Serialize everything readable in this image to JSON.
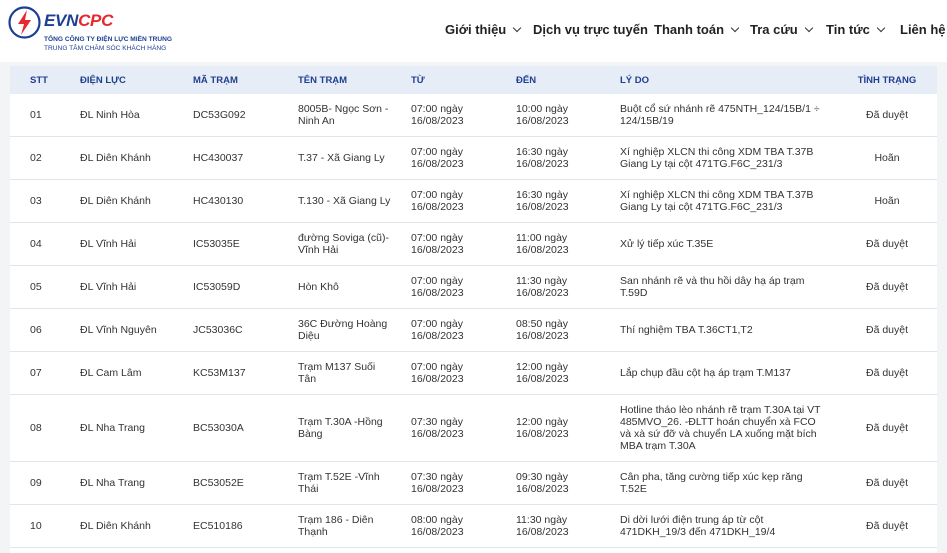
{
  "brand": {
    "name_evn": "EVN",
    "name_cpc": "CPC",
    "line1": "TỔNG CÔNG TY ĐIỆN LỰC MIỀN TRUNG",
    "line2": "TRUNG TÂM CHĂM SÓC KHÁCH HÀNG",
    "colors": {
      "blue": "#1d3f92",
      "red": "#e8272f"
    }
  },
  "nav": {
    "items": [
      {
        "label": "Giới thiệu",
        "has_dropdown": true
      },
      {
        "label": "Dịch vụ trực tuyến",
        "has_dropdown": false
      },
      {
        "label": "Thanh toán",
        "has_dropdown": true
      },
      {
        "label": "Tra cứu",
        "has_dropdown": true
      },
      {
        "label": "Tin tức",
        "has_dropdown": true
      },
      {
        "label": "Liên hệ",
        "has_dropdown": false
      }
    ]
  },
  "table": {
    "headers": [
      "STT",
      "ĐIỆN LỰC",
      "MÃ TRẠM",
      "TÊN TRẠM",
      "TỪ",
      "ĐẾN",
      "LÝ DO",
      "TÌNH TRẠNG"
    ],
    "rows": [
      [
        "01",
        "ĐL Ninh Hòa",
        "DC53G092",
        "8005B- Ngọc Sơn - Ninh An",
        "07:00 ngày 16/08/2023",
        "10:00 ngày 16/08/2023",
        "Buột cổ sứ nhánh rẽ 475NTH_124/15B/1 ÷ 124/15B/19",
        "Đã duyệt"
      ],
      [
        "02",
        "ĐL Diên Khánh",
        "HC430037",
        "T.37 - Xã Giang Ly",
        "07:00 ngày 16/08/2023",
        "16:30 ngày 16/08/2023",
        "Xí nghiệp XLCN thi công XDM TBA T.37B Giang Ly tại cột 471TG.F6C_231/3",
        "Hoãn"
      ],
      [
        "03",
        "ĐL Diên Khánh",
        "HC430130",
        "T.130 - Xã Giang Ly",
        "07:00 ngày 16/08/2023",
        "16:30 ngày 16/08/2023",
        "Xí nghiệp XLCN thi công XDM TBA T.37B Giang Ly tại cột 471TG.F6C_231/3",
        "Hoãn"
      ],
      [
        "04",
        "ĐL Vĩnh Hải",
        "IC53035E",
        "đường Soviga (cũ)- Vĩnh Hải",
        "07:00 ngày 16/08/2023",
        "11:00 ngày 16/08/2023",
        "Xử lý tiếp xúc T.35E",
        "Đã duyệt"
      ],
      [
        "05",
        "ĐL Vĩnh Hải",
        "IC53059D",
        "Hòn Khô",
        "07:00 ngày 16/08/2023",
        "11:30 ngày 16/08/2023",
        "San nhánh rẽ và thu hồi dây hạ áp trạm T.59D",
        "Đã duyệt"
      ],
      [
        "06",
        "ĐL Vĩnh Nguyên",
        "JC53036C",
        "36C Đường Hoàng Diệu",
        "07:00 ngày 16/08/2023",
        "08:50 ngày 16/08/2023",
        "Thí nghiệm TBA T.36CT1,T2",
        "Đã duyệt"
      ],
      [
        "07",
        "ĐL Cam Lâm",
        "KC53M137",
        "Trạm M137 Suối Tân",
        "07:00 ngày 16/08/2023",
        "12:00 ngày 16/08/2023",
        "Lắp chụp đầu cột hạ áp trạm T.M137",
        "Đã duyệt"
      ],
      [
        "08",
        "ĐL Nha Trang",
        "BC53030A",
        "Trạm T.30A -Hồng Bàng",
        "07:30 ngày 16/08/2023",
        "12:00 ngày 16/08/2023",
        "Hotline tháo lèo nhánh rẽ trạm T.30A tại VT 485MVO_26. -ĐLTT hoán chuyển xà FCO và xà sứ đỡ và chuyển LA xuống mặt bích MBA trạm T.30A",
        "Đã duyệt"
      ],
      [
        "09",
        "ĐL Nha Trang",
        "BC53052E",
        "Trạm T.52E -Vĩnh Thái",
        "07:30 ngày 16/08/2023",
        "09:30 ngày 16/08/2023",
        "Cân pha, tăng cường tiếp xúc kẹp răng T.52E",
        "Đã duyệt"
      ],
      [
        "10",
        "ĐL Diên Khánh",
        "EC510186",
        "Trạm 186 - Diên Thạnh",
        "08:00 ngày 16/08/2023",
        "11:30 ngày 16/08/2023",
        "Di dời lưới điện trung áp từ cột 471DKH_19/3 đến 471DKH_19/4",
        "Đã duyệt"
      ]
    ]
  }
}
